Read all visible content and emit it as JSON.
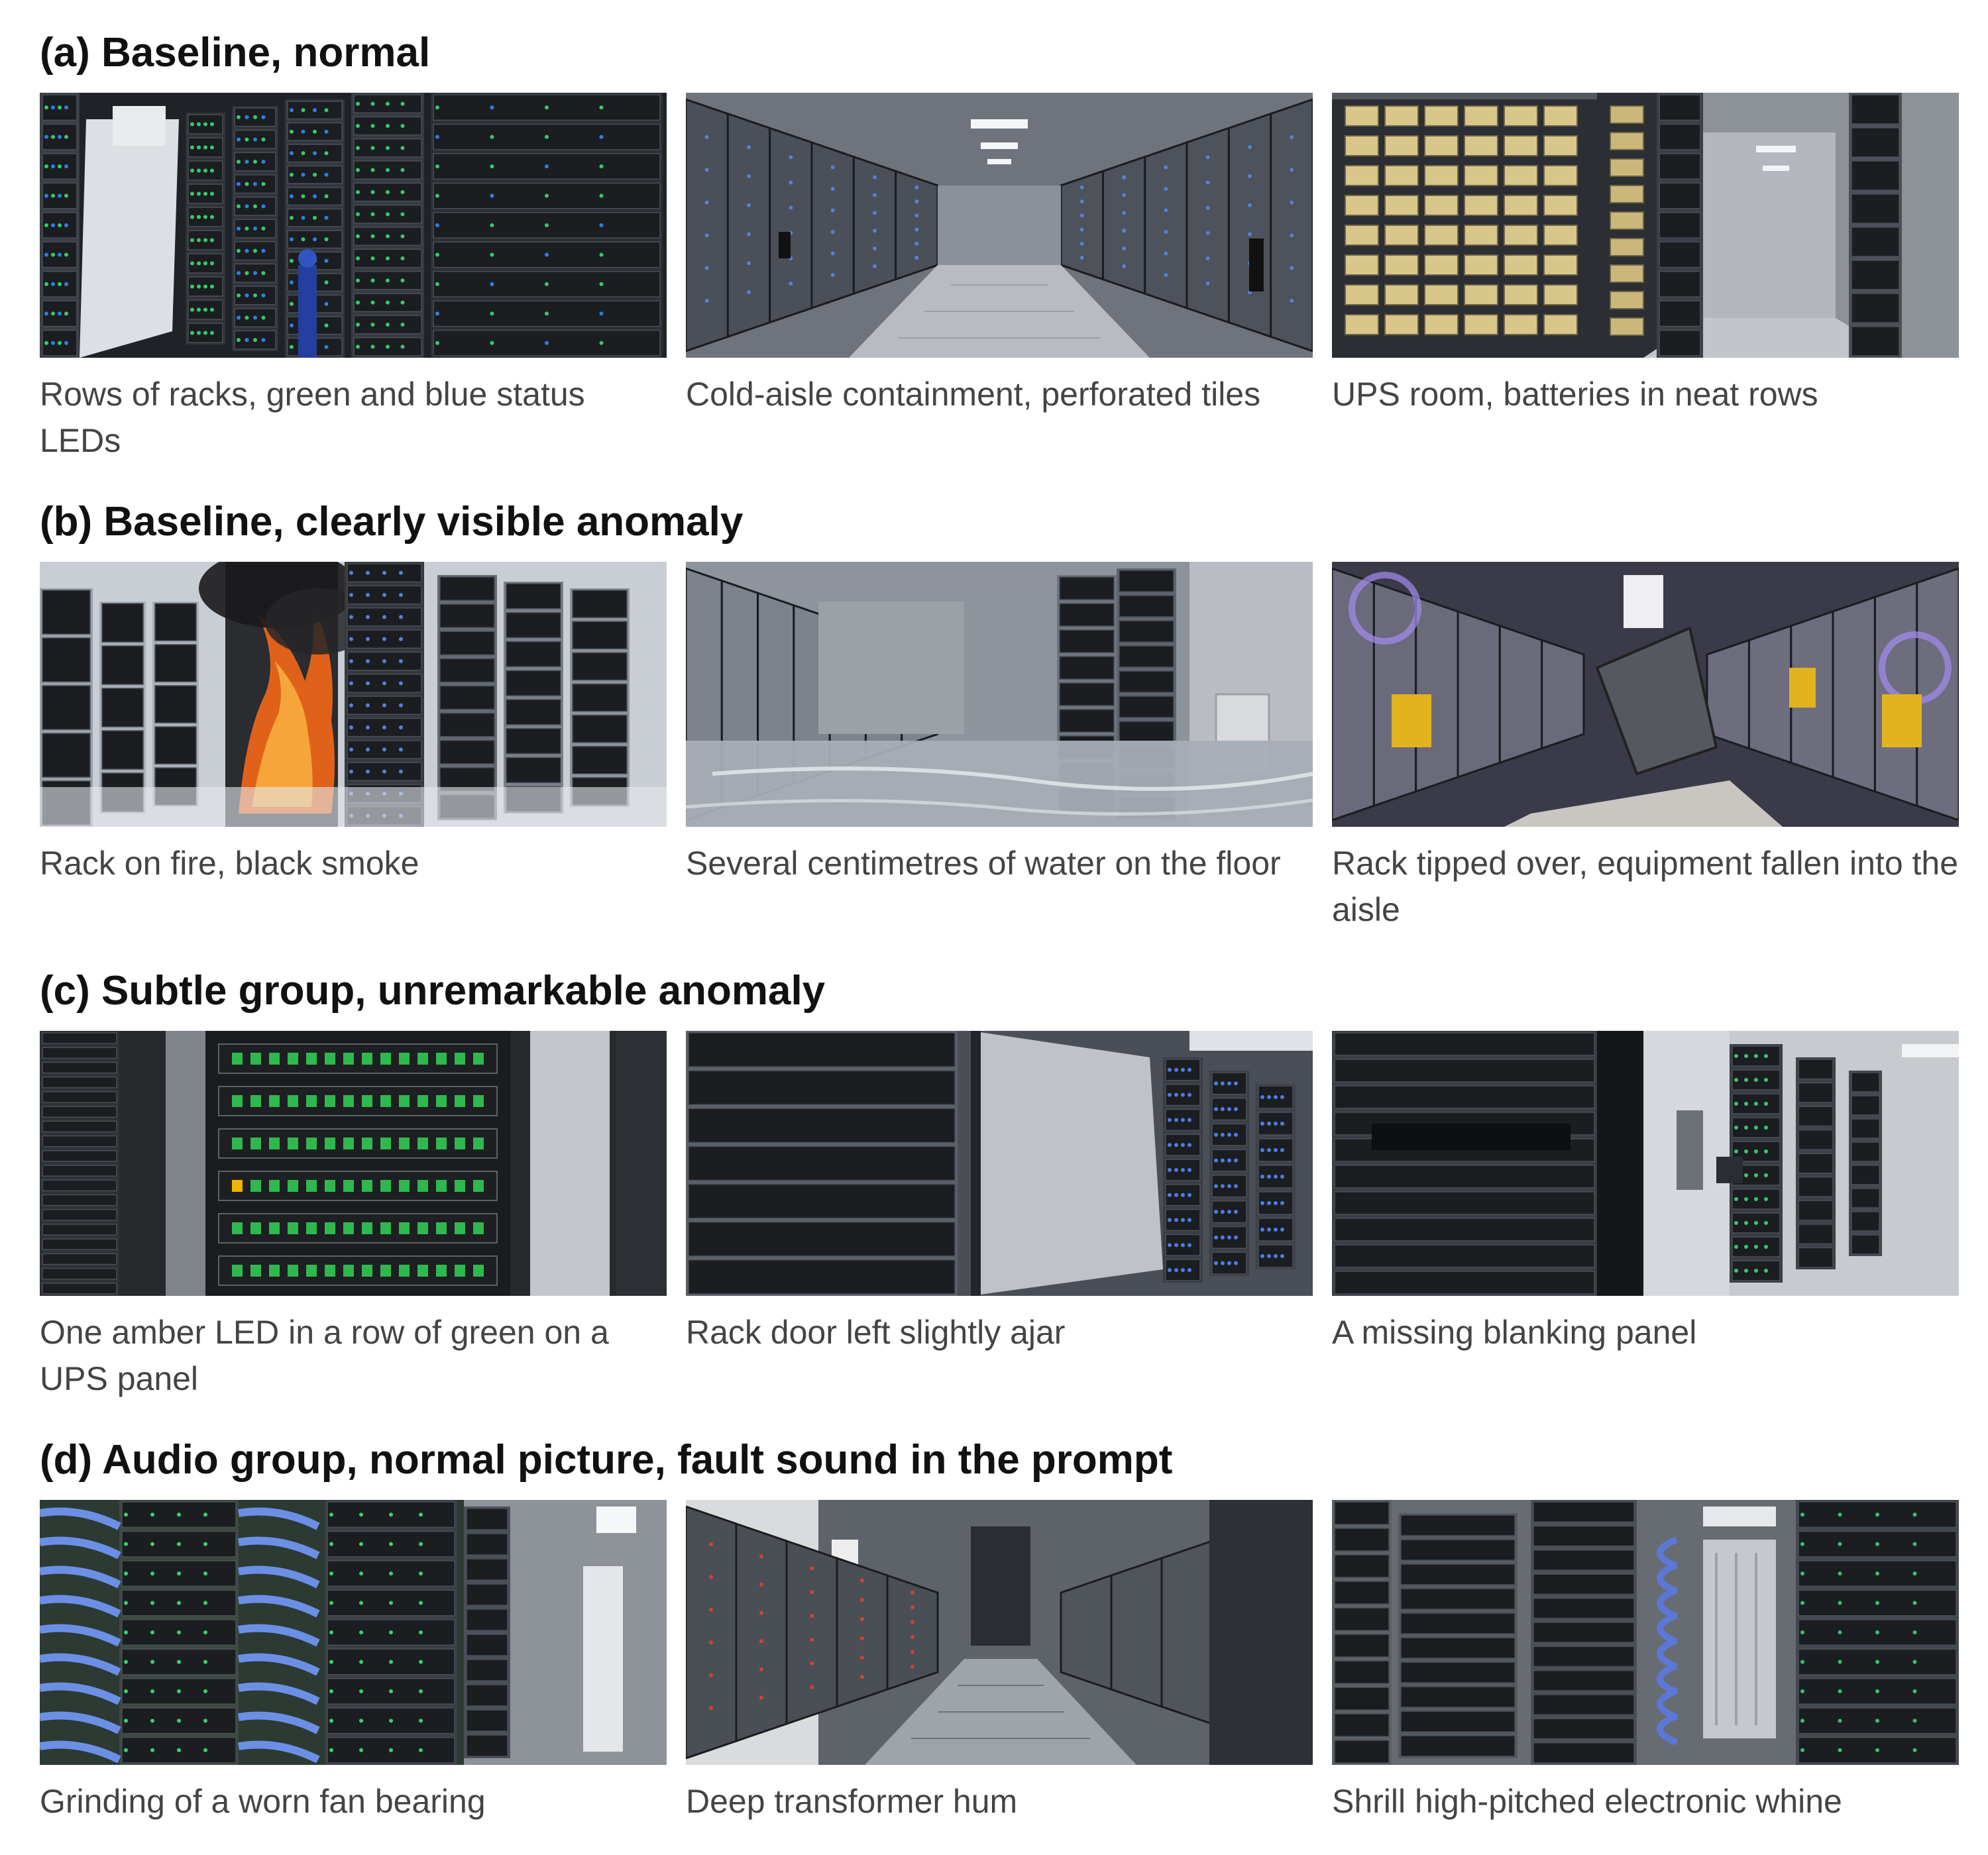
{
  "groups": [
    {
      "title": "(a) Baseline, normal",
      "items": [
        {
          "caption": "Rows of racks, green and blue status LEDs",
          "scene": "rack-row-leds"
        },
        {
          "caption": "Cold-aisle containment, perforated tiles",
          "scene": "cold-aisle"
        },
        {
          "caption": "UPS room, batteries in neat rows",
          "scene": "ups-batteries"
        }
      ]
    },
    {
      "title": "(b) Baseline, clearly visible anomaly",
      "items": [
        {
          "caption": "Rack on fire, black smoke",
          "scene": "rack-fire"
        },
        {
          "caption": "Several centimetres of water on the floor",
          "scene": "flooded-floor"
        },
        {
          "caption": "Rack tipped over, equipment fallen into the aisle",
          "scene": "tipped-rack"
        }
      ]
    },
    {
      "title": "(c) Subtle group, unremarkable anomaly",
      "items": [
        {
          "caption": "One amber LED in a row of green on a UPS panel",
          "scene": "amber-led"
        },
        {
          "caption": "Rack door left slightly ajar",
          "scene": "door-ajar"
        },
        {
          "caption": "A missing blanking panel",
          "scene": "missing-blank"
        }
      ]
    },
    {
      "title": "(d) Audio group, normal picture, fault sound in the prompt",
      "items": [
        {
          "caption": "Grinding of a worn fan bearing",
          "scene": "blue-cables"
        },
        {
          "caption": "Deep transformer hum",
          "scene": "aisle-tiles"
        },
        {
          "caption": "Shrill high-pitched electronic whine",
          "scene": "cable-racks"
        }
      ]
    }
  ]
}
